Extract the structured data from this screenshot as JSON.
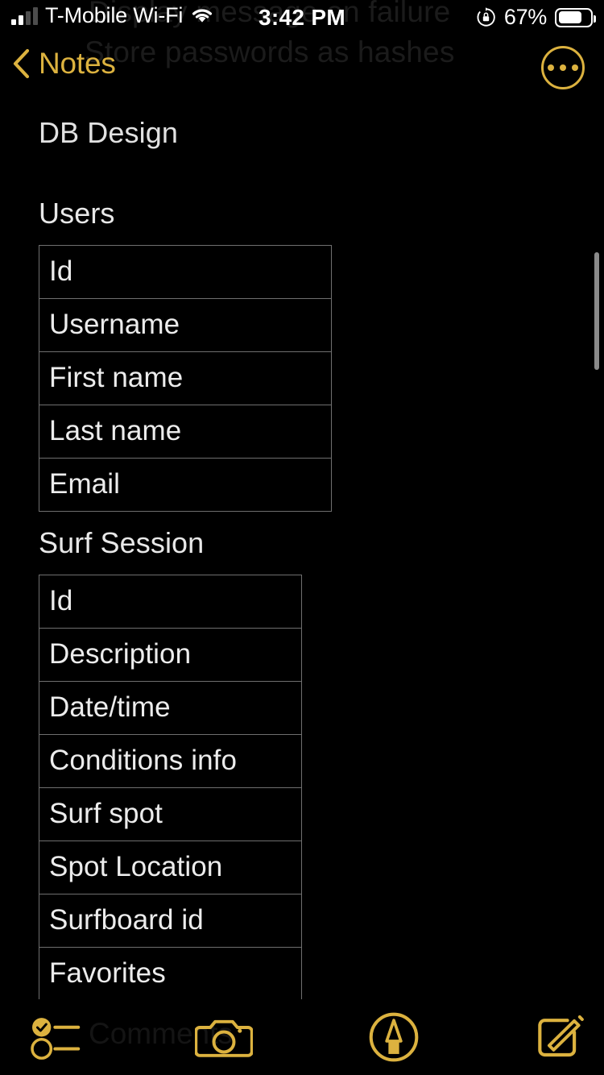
{
  "status_bar": {
    "carrier": "T-Mobile Wi-Fi",
    "time": "3:42 PM",
    "battery_percent": "67%",
    "battery_level": 67,
    "signal_bars_filled": 2,
    "signal_bars_total": 4,
    "wifi_icon": "wifi-icon",
    "rotation_lock_icon": "rotation-lock-icon",
    "battery_icon": "battery-icon"
  },
  "nav_bar": {
    "back_label": "Notes",
    "back_icon": "chevron-left-icon",
    "more_icon": "more-ellipsis-icon"
  },
  "ghost_text": {
    "line1": "Display message on failure",
    "line2": "Store passwords as hashes",
    "bottom": "Comments"
  },
  "note": {
    "title": "DB Design",
    "sections": [
      {
        "heading": "Users",
        "rows": [
          "Id",
          "Username",
          "First name",
          "Last name",
          "Email"
        ]
      },
      {
        "heading": "Surf Session",
        "rows": [
          "Id",
          "Description",
          "Date/time",
          "Conditions info",
          "Surf spot",
          "Spot Location",
          "Surfboard id",
          "Favorites"
        ]
      }
    ]
  },
  "toolbar": {
    "items": [
      {
        "name": "checklist",
        "icon": "checklist-icon"
      },
      {
        "name": "camera",
        "icon": "camera-icon"
      },
      {
        "name": "markup",
        "icon": "markup-pen-icon"
      },
      {
        "name": "compose",
        "icon": "compose-icon"
      }
    ]
  },
  "colors": {
    "accent": "#dcb23f",
    "background": "#000000",
    "text": "#ececec",
    "table_border": "#6f6f6f",
    "scrollbar": "#8a8a8a"
  }
}
